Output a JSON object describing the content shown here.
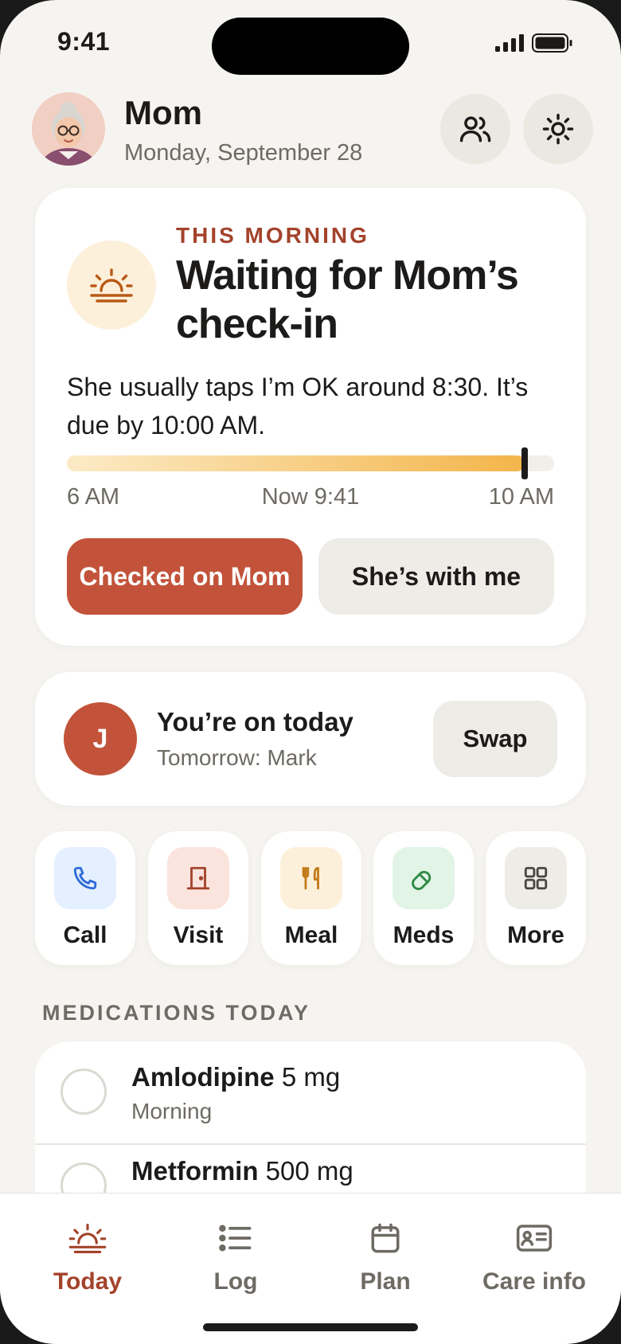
{
  "status_bar": {
    "time": "9:41"
  },
  "header": {
    "name": "Mom",
    "date": "Monday, September 28"
  },
  "checkin": {
    "eyebrow": "THIS MORNING",
    "title": "Waiting for Mom’s check-in",
    "description": "She usually taps I’m OK around 8:30. It’s due by 10:00 AM.",
    "progress_fraction": 0.94,
    "start_label": "6 AM",
    "now_label": "Now 9:41",
    "end_label": "10 AM",
    "primary_button": "Checked on Mom",
    "secondary_button": "She’s with me"
  },
  "duty": {
    "initial": "J",
    "title": "You’re on today",
    "subtitle": "Tomorrow: Mark",
    "swap_label": "Swap"
  },
  "quick_actions": [
    {
      "label": "Call",
      "icon": "phone-icon",
      "bg": "#e4efff",
      "color": "#2f6bd8"
    },
    {
      "label": "Visit",
      "icon": "door-icon",
      "bg": "#fbe4dd",
      "color": "#a3432b"
    },
    {
      "label": "Meal",
      "icon": "utensils-icon",
      "bg": "#fdf0da",
      "color": "#c27a1a"
    },
    {
      "label": "Meds",
      "icon": "pill-icon",
      "bg": "#e2f4e6",
      "color": "#2f8a45"
    },
    {
      "label": "More",
      "icon": "grid-icon",
      "bg": "#eeece6",
      "color": "#4a4743"
    }
  ],
  "medications": {
    "section_title": "MEDICATIONS TODAY",
    "items": [
      {
        "name": "Amlodipine",
        "dose": "5 mg",
        "time": "Morning"
      },
      {
        "name": "Metformin",
        "dose": "500 mg",
        "time": ""
      }
    ]
  },
  "tabs": [
    {
      "label": "Today",
      "icon": "sunrise-icon",
      "active": true
    },
    {
      "label": "Log",
      "icon": "list-icon",
      "active": false
    },
    {
      "label": "Plan",
      "icon": "calendar-icon",
      "active": false
    },
    {
      "label": "Care info",
      "icon": "id-card-icon",
      "active": false
    }
  ],
  "colors": {
    "accent": "#c2533a",
    "accent_text": "#a3432b",
    "background": "#f6f4f0"
  }
}
